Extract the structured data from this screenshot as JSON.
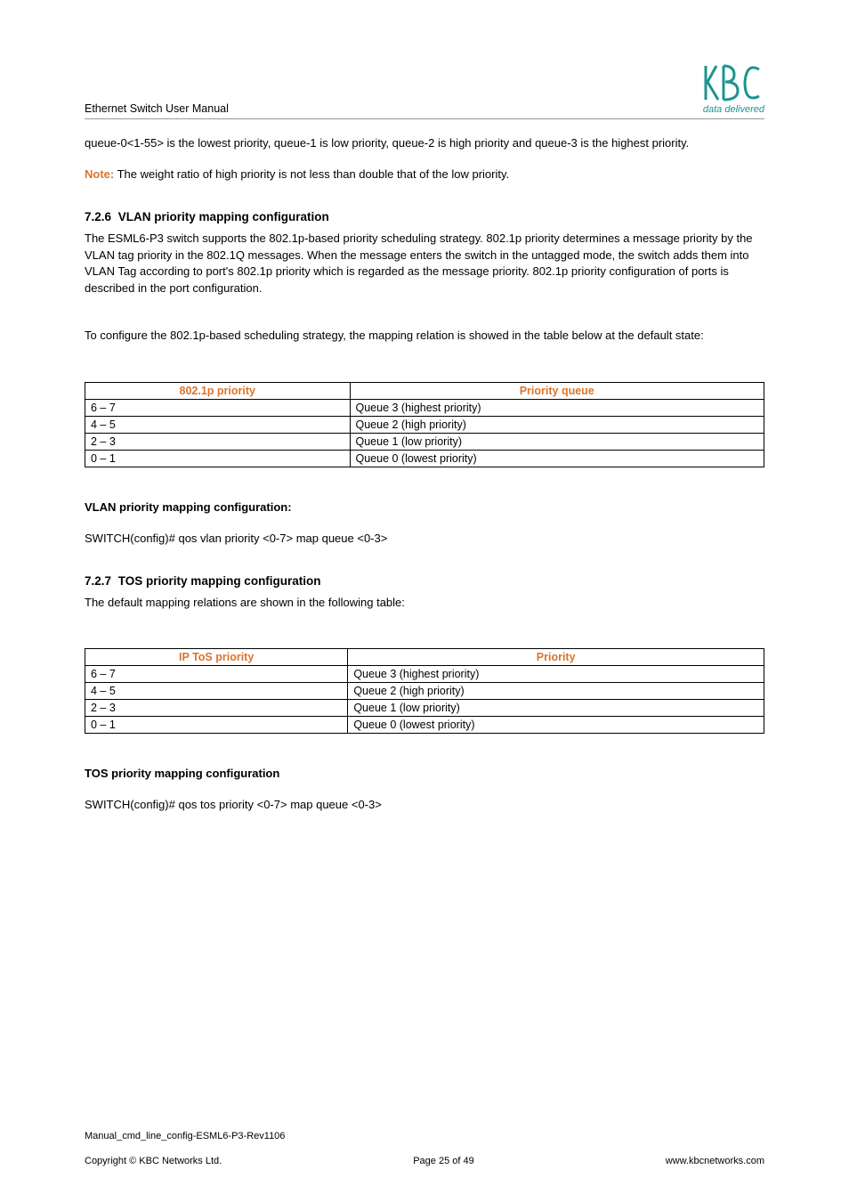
{
  "header": {
    "title": "Ethernet Switch User Manual",
    "tagline": "data delivered"
  },
  "para1": "queue-0<1-55> is the lowest priority, queue-1 is low priority, queue-2 is high priority and queue-3 is the highest priority.",
  "note_label": "Note:",
  "note_text": " The weight ratio of high priority is not less than double that of the low priority.",
  "sec726": {
    "num": "7.2.6",
    "title": "VLAN priority mapping configuration",
    "p1": "The ESML6-P3 switch supports the 802.1p-based priority scheduling strategy. 802.1p priority determines a message priority by the VLAN tag priority in the 802.1Q messages. When the message enters the switch in the untagged mode, the switch adds them into VLAN Tag according to port's 802.1p priority which is regarded as the message priority. 802.1p priority configuration of ports is described in the port configuration.",
    "p2": "To configure the 802.1p-based scheduling strategy, the mapping relation is showed in the table below at the default state:"
  },
  "table1": {
    "h1": "802.1p priority",
    "h2": "Priority queue",
    "rows": [
      {
        "c1": "6 – 7",
        "c2": "Queue 3 (highest priority)"
      },
      {
        "c1": "4 – 5",
        "c2": "Queue 2 (high priority)"
      },
      {
        "c1": "2 – 3",
        "c2": "Queue 1 (low priority)"
      },
      {
        "c1": "0 – 1",
        "c2": "Queue 0 (lowest priority)"
      }
    ]
  },
  "vlan_config_heading": "VLAN priority mapping configuration:",
  "vlan_config_cmd": "SWITCH(config)# qos vlan priority <0-7> map queue <0-3>",
  "sec727": {
    "num": "7.2.7",
    "title": "TOS priority mapping configuration",
    "p1": "The default mapping relations are shown in the following table:"
  },
  "table2": {
    "h1": "IP ToS priority",
    "h2": "Priority",
    "rows": [
      {
        "c1": "6 – 7",
        "c2": "Queue 3 (highest priority)"
      },
      {
        "c1": "4 – 5",
        "c2": "Queue 2 (high priority)"
      },
      {
        "c1": "2 – 3",
        "c2": "Queue 1 (low priority)"
      },
      {
        "c1": "0 – 1",
        "c2": "Queue 0 (lowest priority)"
      }
    ]
  },
  "tos_config_heading": "TOS priority mapping configuration",
  "tos_config_cmd": "SWITCH(config)# qos tos priority <0-7> map queue <0-3>",
  "footer": {
    "rev": "Manual_cmd_line_config-ESML6-P3-Rev1106",
    "copyright": "Copyright © KBC Networks Ltd.",
    "page": "Page 25 of 49",
    "url": "www.kbcnetworks.com"
  }
}
